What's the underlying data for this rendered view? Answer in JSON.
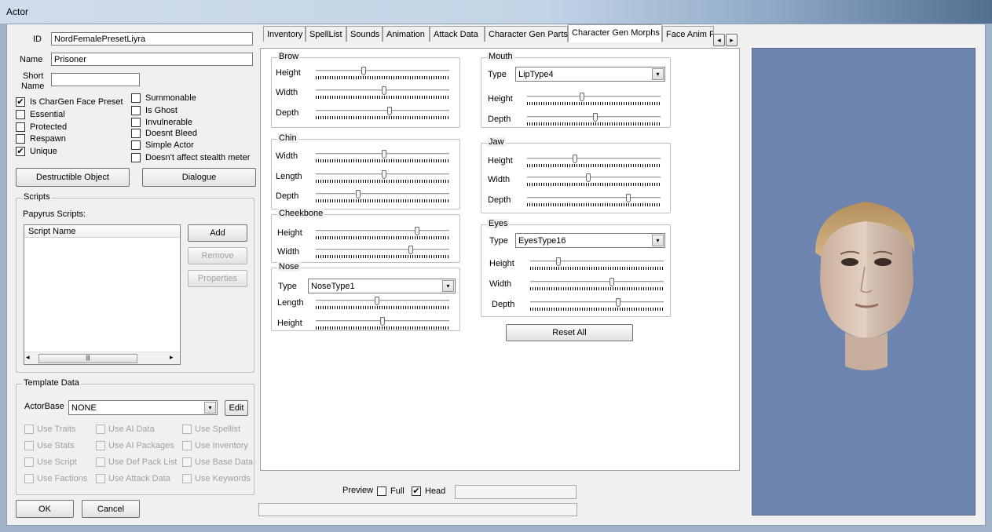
{
  "window": {
    "title": "Actor"
  },
  "identity": {
    "id_label": "ID",
    "id_value": "NordFemalePresetLiyra",
    "name_label": "Name",
    "name_value": "Prisoner",
    "short_name_label_1": "Short",
    "short_name_label_2": "Name",
    "short_name_value": ""
  },
  "flags_left": [
    {
      "label": "Is CharGen Face Preset",
      "checked": "✔"
    },
    {
      "label": "Essential",
      "checked": ""
    },
    {
      "label": "Protected",
      "checked": ""
    },
    {
      "label": "Respawn",
      "checked": ""
    },
    {
      "label": "Unique",
      "checked": "✔"
    }
  ],
  "flags_right": [
    {
      "label": "Summonable",
      "checked": ""
    },
    {
      "label": "Is Ghost",
      "checked": ""
    },
    {
      "label": "Invulnerable",
      "checked": ""
    },
    {
      "label": "Doesnt Bleed",
      "checked": ""
    },
    {
      "label": "Simple Actor",
      "checked": ""
    },
    {
      "label": "Doesn't affect stealth meter",
      "checked": ""
    }
  ],
  "buttons": {
    "destructible": "Destructible Object",
    "dialogue": "Dialogue",
    "ok": "OK",
    "cancel": "Cancel"
  },
  "scripts": {
    "title": "Scripts",
    "papyrus_label": "Papyrus Scripts:",
    "column": "Script Name",
    "add": "Add",
    "remove": "Remove",
    "properties": "Properties",
    "scroll_grip": "|||",
    "left_arrow": "◂",
    "right_arrow": "▸"
  },
  "template": {
    "title": "Template Data",
    "actorbase_label": "ActorBase",
    "actorbase_value": "NONE",
    "edit": "Edit",
    "uses": [
      [
        "Use Traits",
        "Use AI Data",
        "Use Spellist"
      ],
      [
        "Use Stats",
        "Use AI Packages",
        "Use Inventory"
      ],
      [
        "Use Script",
        "Use Def Pack List",
        "Use Base Data"
      ],
      [
        "Use Factions",
        "Use Attack Data",
        "Use Keywords"
      ]
    ]
  },
  "tabs": [
    "Inventory",
    "SpellList",
    "Sounds",
    "Animation",
    "Attack Data",
    "Character Gen Parts",
    "Character Gen Morphs",
    "Face Anim F"
  ],
  "tab_scroll": {
    "left": "◂",
    "right": "▸"
  },
  "morphs": {
    "brow": {
      "title": "Brow",
      "height": "Height",
      "height_pos": 0.36,
      "width": "Width",
      "width_pos": 0.51,
      "depth": "Depth",
      "depth_pos": 0.55
    },
    "chin": {
      "title": "Chin",
      "width": "Width",
      "width_pos": 0.51,
      "length": "Length",
      "length_pos": 0.51,
      "depth": "Depth",
      "depth_pos": 0.32
    },
    "cheekbone": {
      "title": "Cheekbone",
      "height": "Height",
      "height_pos": 0.76,
      "width": "Width",
      "width_pos": 0.71
    },
    "nose": {
      "title": "Nose",
      "type_label": "Type",
      "type_value": "NoseType1",
      "length": "Length",
      "length_pos": 0.46,
      "height": "Height",
      "height_pos": 0.5
    },
    "mouth": {
      "title": "Mouth",
      "type_label": "Type",
      "type_value": "LipType4",
      "height": "Height",
      "height_pos": 0.41,
      "depth": "Depth",
      "depth_pos": 0.51
    },
    "jaw": {
      "title": "Jaw",
      "height": "Height",
      "height_pos": 0.36,
      "width": "Width",
      "width_pos": 0.46,
      "depth": "Depth",
      "depth_pos": 0.76
    },
    "eyes": {
      "title": "Eyes",
      "type_label": "Type",
      "type_value": "EyesType16",
      "height": "Height",
      "height_pos": 0.21,
      "width": "Width",
      "width_pos": 0.61,
      "depth": "Depth",
      "depth_pos": 0.66
    }
  },
  "reset_all": "Reset All",
  "preview": {
    "label": "Preview",
    "full_label": "Full",
    "full_checked": "",
    "head_label": "Head",
    "head_checked": "✔",
    "background": "#6e84b0"
  },
  "icons": {
    "dropdown": "▾",
    "check": "✔"
  }
}
